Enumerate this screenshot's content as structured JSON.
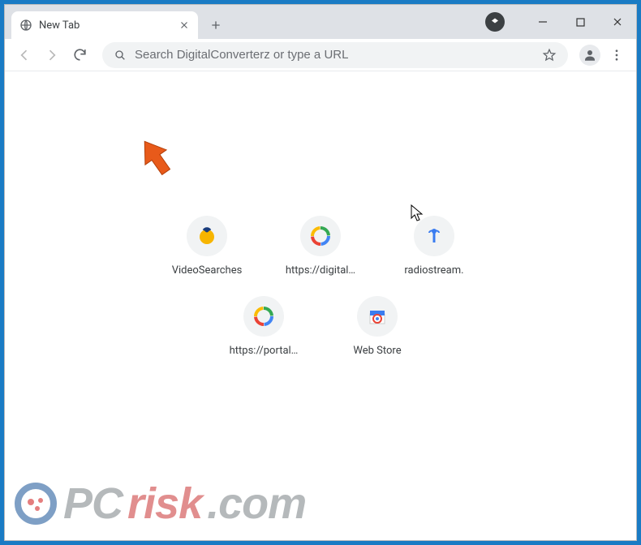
{
  "tab": {
    "title": "New Tab"
  },
  "omnibox": {
    "placeholder": "Search DigitalConverterz or type a URL",
    "value": ""
  },
  "shortcuts": {
    "row1": [
      {
        "label": "VideoSearches"
      },
      {
        "label": "https://digital…"
      },
      {
        "label": "radiostream."
      }
    ],
    "row2": [
      {
        "label": "https://portal…"
      },
      {
        "label": "Web Store"
      }
    ]
  },
  "watermark": {
    "pre": "PC",
    "accent": "risk",
    "suffix": ".com"
  }
}
